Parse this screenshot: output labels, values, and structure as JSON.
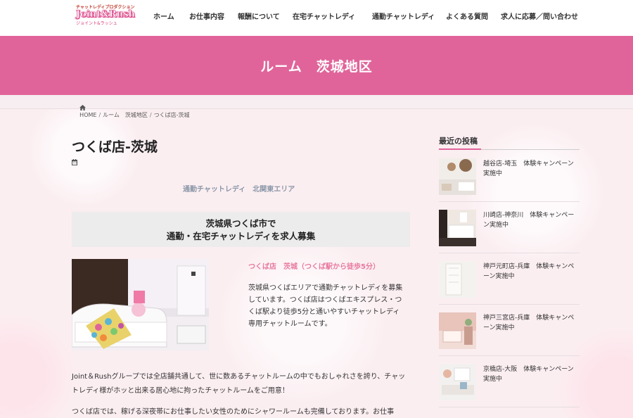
{
  "logo": {
    "line1": "チャットレディプロダクション",
    "line2": "Joint&Rush",
    "line3": "ジョイント&ラッシュ"
  },
  "nav": [
    {
      "label": "ホーム"
    },
    {
      "label": "お仕事内容"
    },
    {
      "label": "報酬について"
    },
    {
      "label": "在宅チャットレディ"
    },
    {
      "label": "通勤チャットレディ"
    },
    {
      "label": "よくある質問"
    },
    {
      "label": "求人に応募／問い合わせ"
    }
  ],
  "banner": {
    "title": "ルーム　茨城地区"
  },
  "breadcrumb": {
    "home": "HOME",
    "sep": "/",
    "level1": "ルーム　茨城地区",
    "current": "つくば店-茨城"
  },
  "post": {
    "title": "つくば店-茨城",
    "categories": [
      "通勤チャットレディ",
      "北関東エリア"
    ],
    "headline": [
      "茨城県つくば市で",
      "通勤・在宅チャットレディを求人募集"
    ],
    "shop_name": "つくば店　茨城（つくば駅から徒歩5分）",
    "shop_desc": [
      "茨城県つくばエリアで通勤チャットレディを募集",
      "しています。つくば店はつくばエキスプレス・つ",
      "くば駅より徒歩5分と通いやすいチャットレディ",
      "専用チャットルームです。"
    ],
    "para1": [
      "Joint＆Rushグループでは全店舗共通して、世に数あるチャットルームの中でもおしゃれさを誇り、チャッ",
      "トレディ様がホッと出来る居心地に拘ったチャットルームをご用意！"
    ],
    "para2": [
      "つくば店では、稼げる深夜帯にお仕事したい女性のためにシャワールームも完備しております。お仕事"
    ]
  },
  "sidebar": {
    "title": "最近の投稿",
    "items": [
      {
        "line1": "越谷店-埼玉　体験キャンペーン",
        "line2": "実施中"
      },
      {
        "line1": "川崎店-神奈川　体験キャンペー",
        "line2": "ン実施中"
      },
      {
        "line1": "神戸元町店-兵庫　体験キャンペ",
        "line2": "ーン実施中"
      },
      {
        "line1": "神戸三宮店-兵庫　体験キャンペ",
        "line2": "ーン実施中"
      },
      {
        "line1": "京橋店-大阪　体験キャンペーン",
        "line2": "実施中"
      }
    ]
  },
  "colors": {
    "accent": "#e0649a",
    "shop_name": "#e8789e",
    "category": "#8b97a8"
  }
}
